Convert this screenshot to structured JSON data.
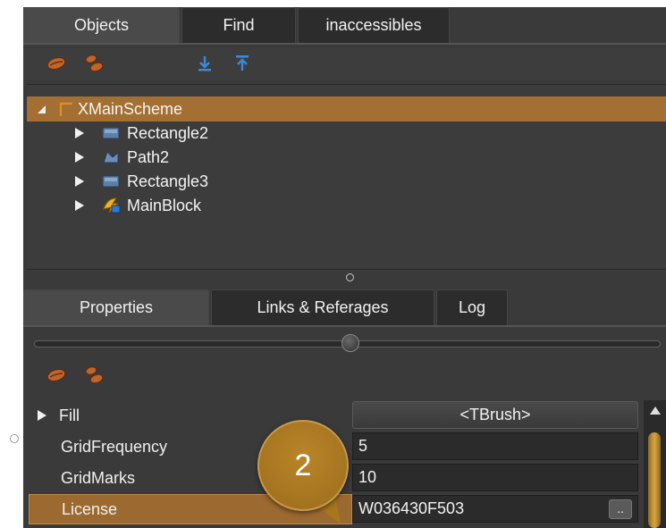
{
  "top_tabs": [
    {
      "label": "Objects",
      "active": true
    },
    {
      "label": "Find",
      "active": false
    },
    {
      "label": "inaccessibles",
      "active": false
    }
  ],
  "objects_toolbar": {
    "icons": [
      "bean-single-icon",
      "bean-double-icon",
      "arrow-down-to-line-icon",
      "arrow-up-to-line-icon"
    ]
  },
  "tree": {
    "root": {
      "label": "XMainScheme",
      "icon": "scheme-icon",
      "expanded": true,
      "selected": true
    },
    "children": [
      {
        "label": "Rectangle2",
        "icon": "rectangle-icon"
      },
      {
        "label": "Path2",
        "icon": "path-icon"
      },
      {
        "label": "Rectangle3",
        "icon": "rectangle-icon"
      },
      {
        "label": "MainBlock",
        "icon": "block-icon"
      }
    ]
  },
  "bottom_tabs": [
    {
      "label": "Properties",
      "active": true
    },
    {
      "label": "Links & Referages",
      "active": false
    },
    {
      "label": "Log",
      "active": false
    }
  ],
  "properties_toolbar": {
    "icons": [
      "bean-single-icon",
      "bean-double-icon"
    ]
  },
  "slider": {
    "position_fraction": 0.5
  },
  "properties": [
    {
      "name": "Fill",
      "value": "<TBrush>",
      "expandable": true,
      "kind": "button"
    },
    {
      "name": "GridFrequency",
      "value": "5"
    },
    {
      "name": "GridMarks",
      "value": "10"
    },
    {
      "name": "License",
      "value": "W036430F503",
      "selected": true,
      "ellipsis": ".."
    }
  ],
  "callout": {
    "number": "2"
  },
  "colors": {
    "panel_bg": "#3a3a3a",
    "selection": "#a36f32",
    "accent_gold": "#d9a63c",
    "callout": "#b07d22"
  }
}
